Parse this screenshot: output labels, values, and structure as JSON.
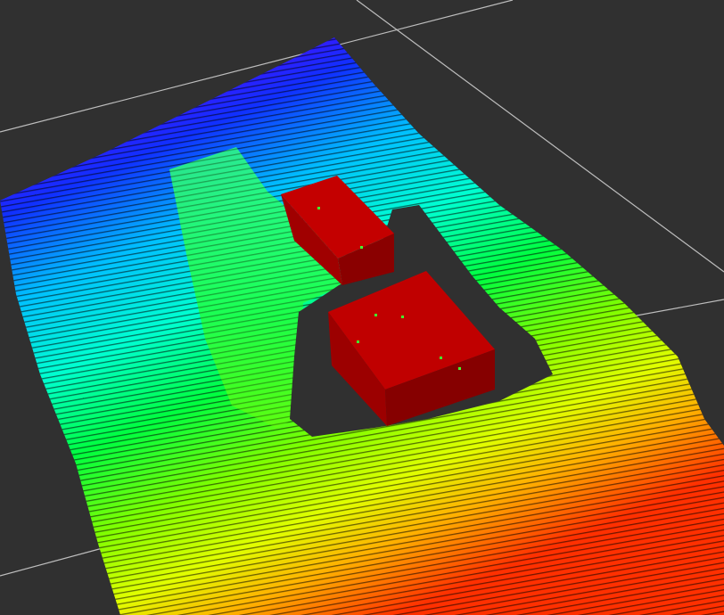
{
  "app": {
    "view": "3d-viewport",
    "background_color": "#303030",
    "grid_color": "#bdbdbd"
  },
  "scene": {
    "point_cloud": {
      "colormap": "rainbow",
      "color_stops": [
        "#ff2000",
        "#ffa000",
        "#ffff00",
        "#a0ff00",
        "#00ff30",
        "#00ffff",
        "#0080ff",
        "#1020ff",
        "#8000ff",
        "#c000ff"
      ]
    },
    "objects": [
      {
        "name": "box-back",
        "color": "#b00000"
      },
      {
        "name": "box-front",
        "color": "#b00000"
      }
    ]
  }
}
